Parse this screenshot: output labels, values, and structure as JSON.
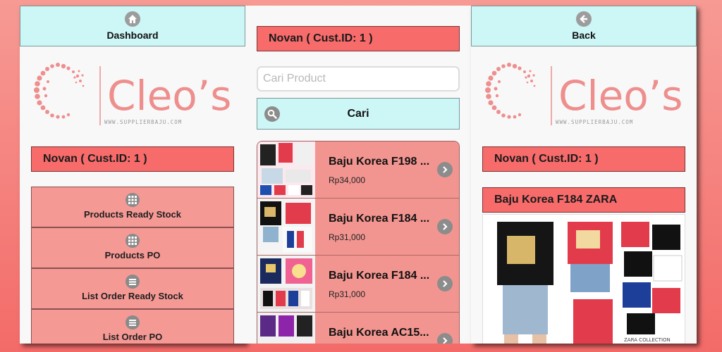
{
  "left_panel": {
    "header_label": "Dashboard",
    "header_icon": "home-icon",
    "user_label": "Novan ( Cust.ID: 1 )",
    "logo": {
      "brand": "Cleo’s",
      "tagline": "WWW.SUPPLIERBAJU.COM"
    },
    "menu": [
      {
        "label": "Products Ready Stock",
        "icon": "grid-icon"
      },
      {
        "label": "Products PO",
        "icon": "grid-icon"
      },
      {
        "label": "List Order Ready Stock",
        "icon": "list-icon"
      },
      {
        "label": "List Order PO",
        "icon": "list-icon"
      }
    ]
  },
  "middle_panel": {
    "user_label": "Novan ( Cust.ID: 1 )",
    "search": {
      "placeholder": "Cari Product",
      "value": ""
    },
    "search_button_label": "Cari",
    "products": [
      {
        "name": "Baju Korea F198 ...",
        "price": "Rp34,000"
      },
      {
        "name": "Baju Korea F184 ...",
        "price": "Rp31,000"
      },
      {
        "name": "Baju Korea F184 ...",
        "price": "Rp31,000"
      },
      {
        "name": "Baju Korea AC15...",
        "price": ""
      }
    ]
  },
  "right_panel": {
    "header_label": "Back",
    "header_icon": "back-arrow-icon",
    "user_label": "Novan ( Cust.ID: 1 )",
    "logo": {
      "brand": "Cleo’s",
      "tagline": "WWW.SUPPLIERBAJU.COM"
    },
    "product_title": "Baju Korea F184 ZARA",
    "product_image_caption": "ZARA COLLECTION"
  },
  "colors": {
    "accent_red": "#f76b6b",
    "button_cyan": "#cdf6f6",
    "menu_pink": "#f59995",
    "logo_pink": "#ee8f8e"
  }
}
